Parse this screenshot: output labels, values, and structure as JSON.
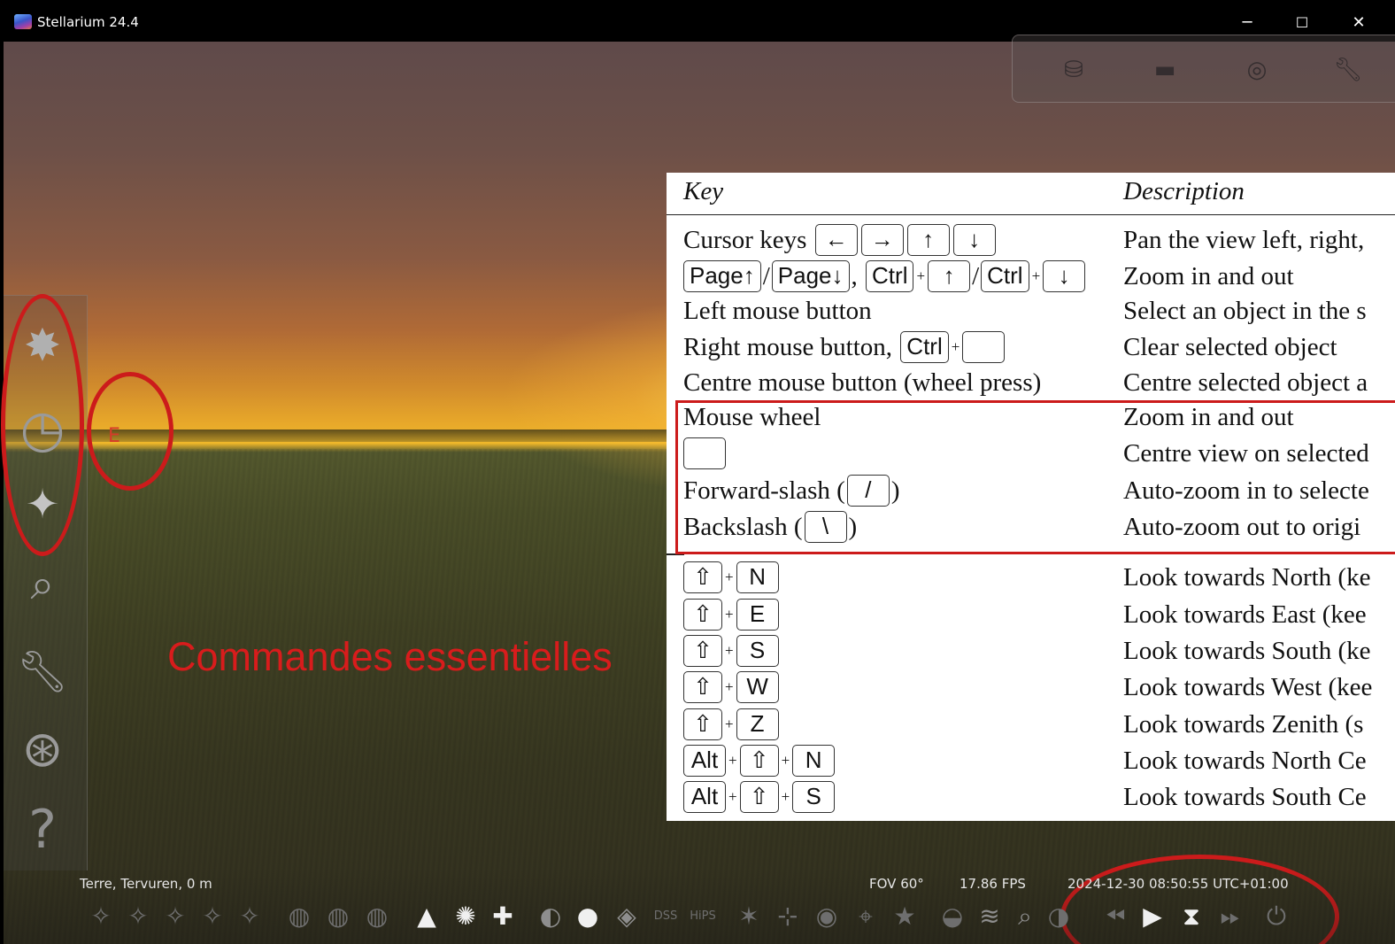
{
  "window": {
    "title": "Stellarium 24.4",
    "minimize": "─",
    "maximize": "☐",
    "close": "✕"
  },
  "scene": {
    "cardinal_point": "E"
  },
  "annotation": {
    "label": "Commandes essentielles",
    "color": "#cc1b1b"
  },
  "top_toolbar": {
    "icons": [
      "bucket-icon",
      "screen-icon",
      "target-icon",
      "wrench-icon"
    ]
  },
  "sidebar": {
    "items": [
      {
        "icon": "location-star-icon"
      },
      {
        "icon": "clock-icon"
      },
      {
        "icon": "sky-display-icon"
      },
      {
        "icon": "search-icon"
      },
      {
        "icon": "settings-wrench-icon"
      },
      {
        "icon": "astro-calc-icon"
      },
      {
        "icon": "help-icon",
        "glyph": "?"
      }
    ]
  },
  "key_table": {
    "header_key": "Key",
    "header_description": "Description",
    "rows": [
      {
        "desc": "Pan the view left, right,"
      },
      {
        "desc": "Zoom in and out"
      },
      {
        "key": "Left mouse button",
        "desc": "Select an object in the s"
      },
      {
        "desc": "Clear selected object"
      },
      {
        "key": "Centre mouse button (wheel press)",
        "desc": "Centre selected object a"
      },
      {
        "key": "Mouse wheel",
        "desc": "Zoom in and out"
      },
      {
        "desc": "Centre view on selected"
      },
      {
        "desc": "Auto-zoom in to selecte"
      },
      {
        "desc": "Auto-zoom out to origi"
      },
      {
        "desc": "Look towards North (ke"
      },
      {
        "desc": "Look towards East (kee"
      },
      {
        "desc": "Look towards South (ke"
      },
      {
        "desc": "Look towards West (kee"
      },
      {
        "desc": "Look towards Zenith (s"
      },
      {
        "desc": "Look towards North Ce"
      },
      {
        "desc": "Look towards South Ce"
      }
    ],
    "text": {
      "cursor_keys": "Cursor keys",
      "right_mouse": "Right mouse button,",
      "forward_slash": "Forward-slash (",
      "backslash": "Backslash (",
      "close_paren": ")",
      "comma": ",",
      "slash": "/",
      "plus": "+"
    },
    "kbd": {
      "left": "←",
      "right": "→",
      "up": "↑",
      "down": "↓",
      "page_up": "Page↑",
      "page_down": "Page↓",
      "ctrl": "Ctrl",
      "space": "",
      "slash": "/",
      "backslash": "\\",
      "shift": "⇧",
      "alt": "Alt",
      "n": "N",
      "e": "E",
      "s": "S",
      "w": "W",
      "z": "Z"
    }
  },
  "status_bar": {
    "location": "Terre, Tervuren, 0 m",
    "fov": "FOV 60°",
    "fps": "17.86 FPS",
    "datetime": "2024-12-30 08:50:55 UTC+01:00"
  },
  "bottom_toolbar": {
    "icons": [
      "constellation-lines-icon",
      "constellation-labels-icon",
      "constellation-art-icon",
      "constellation-boundaries-icon",
      "asterism-icon",
      "equatorial-grid-icon",
      "azimuthal-grid-icon",
      "galactic-grid-icon",
      "ground-icon",
      "atmosphere-icon",
      "cardinal-points-icon",
      "nebulae-icon",
      "planets-icon",
      "satellites-icon",
      "dss-icon",
      "hips-icon",
      "meteor-icon",
      "ocular-icon",
      "eye-icon",
      "telescope-icon",
      "bookmark-icon",
      "mount-icon",
      "exoplanet-icon",
      "zoom-icon",
      "night-mode-icon",
      "rewind-icon",
      "play-icon",
      "now-icon",
      "fast-forward-icon",
      "quit-icon"
    ]
  }
}
